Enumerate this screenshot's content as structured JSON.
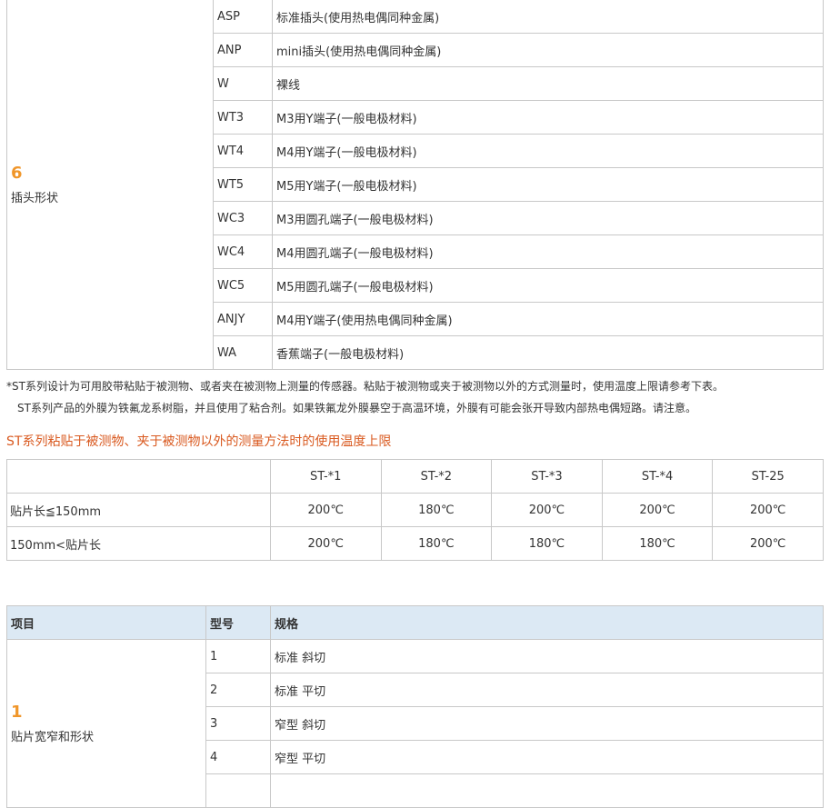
{
  "table1": {
    "section_number": "6",
    "section_label": "插头形状",
    "rows": [
      {
        "code": "ASP",
        "desc": "标准插头(使用热电偶同种金属)"
      },
      {
        "code": "ANP",
        "desc": "mini插头(使用热电偶同种金属)"
      },
      {
        "code": "W",
        "desc": "裸线"
      },
      {
        "code": "WT3",
        "desc": "M3用Y端子(一般电极材料)"
      },
      {
        "code": "WT4",
        "desc": "M4用Y端子(一般电极材料)"
      },
      {
        "code": "WT5",
        "desc": "M5用Y端子(一般电极材料)"
      },
      {
        "code": "WC3",
        "desc": "M3用圆孔端子(一般电极材料)"
      },
      {
        "code": "WC4",
        "desc": "M4用圆孔端子(一般电极材料)"
      },
      {
        "code": "WC5",
        "desc": "M5用圆孔端子(一般电极材料)"
      },
      {
        "code": "ANJY",
        "desc": "M4用Y端子(使用热电偶同种金属)"
      },
      {
        "code": "WA",
        "desc": "香蕉端子(一般电极材料)"
      }
    ]
  },
  "notes": {
    "line1": "*ST系列设计为可用胶带粘贴于被测物、或者夹在被测物上测量的传感器。粘贴于被测物或夹于被测物以外的方式测量时，使用温度上限请参考下表。",
    "line2": "ST系列产品的外膜为铁氟龙系树脂，并且使用了粘合剂。如果铁氟龙外膜暴空于高温环境，外膜有可能会张开导致内部热电偶短路。请注意。"
  },
  "table2": {
    "title": "ST系列粘贴于被测物、夹于被测物以外的测量方法时的使用温度上限",
    "headers": [
      "",
      "ST-*1",
      "ST-*2",
      "ST-*3",
      "ST-*4",
      "ST-25"
    ],
    "rows": [
      {
        "label": "贴片长≦150mm",
        "values": [
          "200℃",
          "180℃",
          "200℃",
          "200℃",
          "200℃"
        ]
      },
      {
        "label": "150mm<贴片长",
        "values": [
          "200℃",
          "180℃",
          "180℃",
          "180℃",
          "200℃"
        ]
      }
    ]
  },
  "table3": {
    "headers": [
      "项目",
      "型号",
      "规格"
    ],
    "section_number": "1",
    "section_label": "贴片宽窄和形状",
    "rows": [
      {
        "code": "1",
        "desc": "标准 斜切"
      },
      {
        "code": "2",
        "desc": "标准 平切"
      },
      {
        "code": "3",
        "desc": "窄型 斜切"
      },
      {
        "code": "4",
        "desc": "窄型 平切"
      }
    ]
  }
}
